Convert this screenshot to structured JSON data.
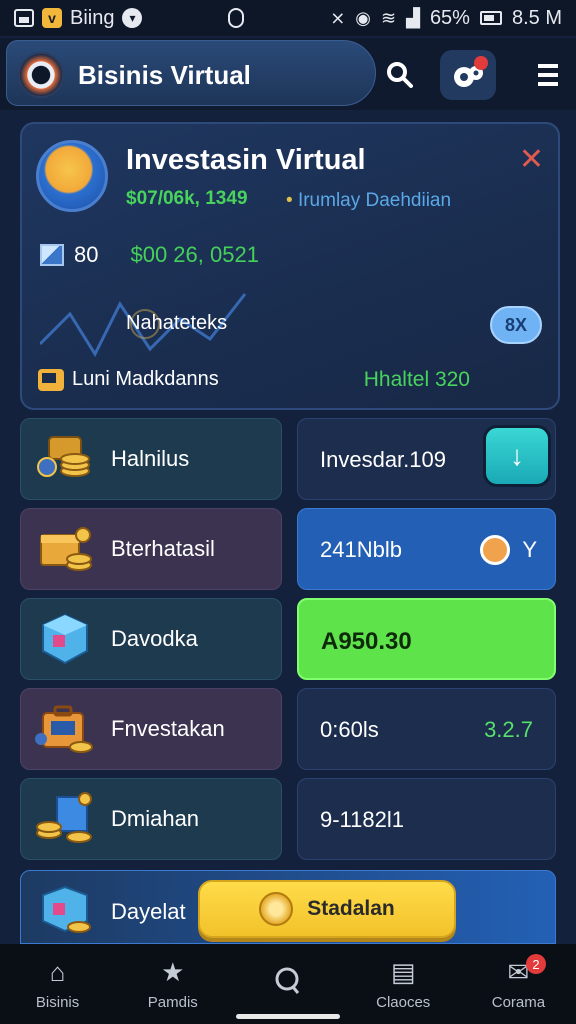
{
  "status_bar": {
    "carrier": "Biing",
    "battery": "65%",
    "time": "8.5 M"
  },
  "header": {
    "title": "Bisinis Virtual"
  },
  "main_card": {
    "title": "Investasin Virtual",
    "subtitle_left": "$07/06k, 1349",
    "subtitle_right": "Irumlay Daehdiian",
    "count": "80",
    "amount": "$00 26, 0521",
    "label": "Nahateteks",
    "pill": "8X",
    "bottom_left": "Luni Madkdanns",
    "bottom_right": "Hhaltel 320"
  },
  "rows": [
    {
      "left_label": "Halnilus",
      "right_value": "Invesdar.109"
    },
    {
      "left_label": "Bterhatasil",
      "right_value": "241Nblb",
      "right_extra": "Y"
    },
    {
      "left_label": "Davodka",
      "right_value": "A950.30"
    },
    {
      "left_label": "Fnvestakan",
      "right_value": "0:60ls",
      "right_extra": "3.2.7"
    },
    {
      "left_label": "Dmiahan",
      "right_value": "9-1182l1"
    },
    {
      "left_label": "Dayelat"
    }
  ],
  "cta": {
    "label": "Stadalan"
  },
  "bottom_nav": [
    {
      "label": "Bisinis",
      "icon": "home-icon"
    },
    {
      "label": "Pamdis",
      "icon": "star-icon"
    },
    {
      "label": "",
      "icon": "search-icon"
    },
    {
      "label": "Claoces",
      "icon": "document-icon"
    },
    {
      "label": "Corama",
      "icon": "mail-icon",
      "badge": "2"
    }
  ],
  "colors": {
    "background": "#14213d",
    "accent_green": "#5ee34b",
    "accent_blue": "#2360b5",
    "cta_yellow": "#ffdc4a"
  }
}
